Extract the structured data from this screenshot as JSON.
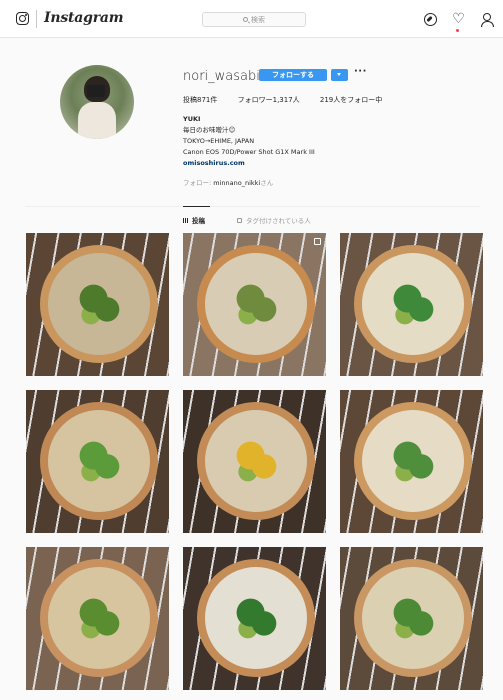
{
  "header": {
    "brand": "Instagram",
    "search_placeholder": "検索"
  },
  "profile": {
    "username": "nori_wasabi",
    "follow_label": "フォローする",
    "more_label": "···",
    "stats": {
      "posts": "投稿871件",
      "followers": "フォロワー1,317人",
      "following": "219人をフォロー中"
    },
    "bio": {
      "name": "YUKI",
      "line1": "毎日のお味噌汁☺",
      "line2": "TOKYO→EHIME, JAPAN",
      "line3": "Canon EOS 70D/Power Shot G1X Mark III",
      "link": "omisoshirus.com"
    },
    "followed_by_prefix": "フォロー: ",
    "followed_by_user": "minnano_nikki",
    "followed_by_suffix": "さん"
  },
  "tabs": {
    "posts": "投稿",
    "tagged": "タグ付けされている人"
  },
  "posts": [
    {
      "subject": "miso soup with mushrooms and green onions"
    },
    {
      "subject": "miso soup with sudachi slices and nori",
      "multi": true
    },
    {
      "subject": "miso soup with chikuwa and greens"
    },
    {
      "subject": "miso soup with fried tofu and green onions"
    },
    {
      "subject": "miso soup with zucchini and bell peppers"
    },
    {
      "subject": "miso soup with tofu and spinach"
    },
    {
      "subject": "miso soup with tofu and green onions"
    },
    {
      "subject": "miso soup with grated daikon and spinach"
    },
    {
      "subject": "miso soup with tofu and wakame"
    }
  ]
}
